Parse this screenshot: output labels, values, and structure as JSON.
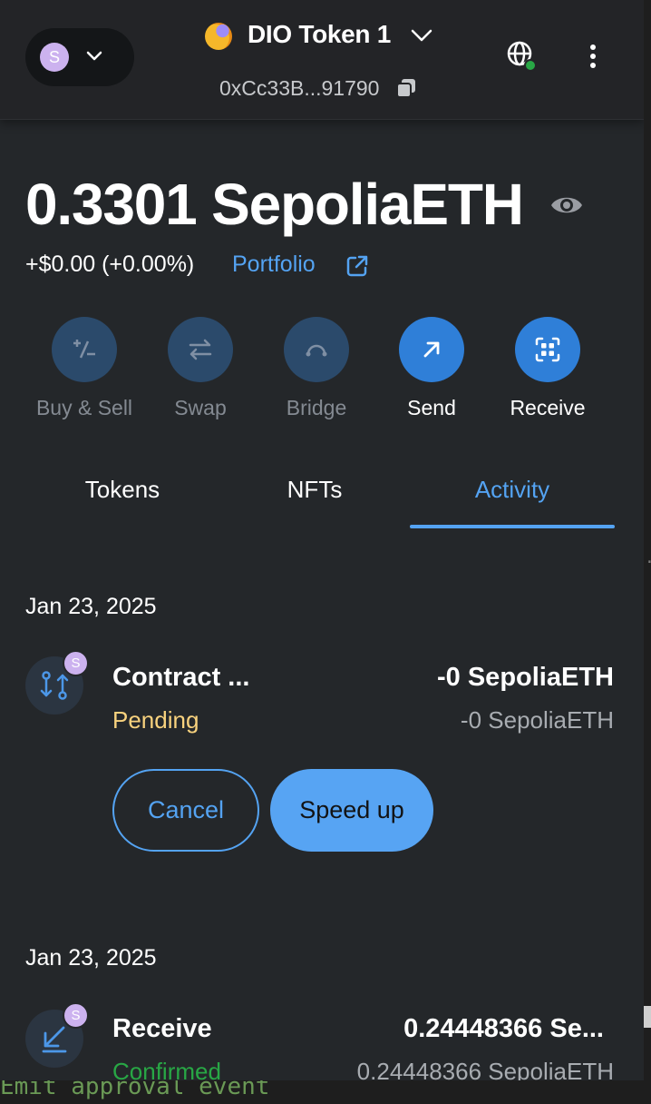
{
  "header": {
    "account_initial": "S",
    "account_name": "DIO Token 1",
    "address": "0xCc33B...91790"
  },
  "balance": {
    "amount": "0.3301 SepoliaETH",
    "change": "+$0.00 (+0.00%)",
    "portfolio_label": "Portfolio"
  },
  "actions": [
    {
      "label": "Buy & Sell",
      "icon": "buy-sell-icon",
      "enabled": false
    },
    {
      "label": "Swap",
      "icon": "swap-icon",
      "enabled": false
    },
    {
      "label": "Bridge",
      "icon": "bridge-icon",
      "enabled": false
    },
    {
      "label": "Send",
      "icon": "send-arrow-icon",
      "enabled": true
    },
    {
      "label": "Receive",
      "icon": "qr-code-icon",
      "enabled": true
    }
  ],
  "tabs": [
    {
      "label": "Tokens",
      "active": false
    },
    {
      "label": "NFTs",
      "active": false
    },
    {
      "label": "Activity",
      "active": true
    }
  ],
  "activity": [
    {
      "date": "Jan 23, 2025",
      "badge": "S",
      "title": "Contract ...",
      "status": "Pending",
      "amount": "-0 SepoliaETH",
      "amount_secondary": "-0 SepoliaETH",
      "cancel_label": "Cancel",
      "speedup_label": "Speed up"
    },
    {
      "date": "Jan 23, 2025",
      "badge": "S",
      "title": "Receive",
      "status": "Confirmed",
      "amount": "0.24448366 Se...",
      "amount_secondary": "0.24448366 SepoliaETH"
    }
  ],
  "background_text": "Emit approval event",
  "colors": {
    "accent": "#54a3f2",
    "pending": "#f8d27e",
    "confirmed": "#28a745",
    "avatar": "#ccb2ef",
    "background": "#24272a"
  }
}
